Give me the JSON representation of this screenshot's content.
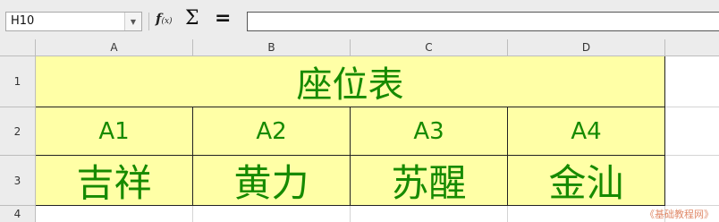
{
  "formula_bar": {
    "name_box": "H10",
    "fx_label": "f(x)",
    "sigma_label": "Σ",
    "equals_label": "=",
    "content": ""
  },
  "columns": [
    "A",
    "B",
    "C",
    "D"
  ],
  "rows": [
    "1",
    "2",
    "3",
    "4"
  ],
  "sheet": {
    "title": "座位表",
    "codes": [
      "A1",
      "A2",
      "A3",
      "A4"
    ],
    "names": [
      "吉祥",
      "黄力",
      "苏醒",
      "金汕"
    ]
  },
  "colors": {
    "cell_fill": "#ffffa6",
    "text": "#168a00"
  },
  "watermark": "《基础教程网》"
}
